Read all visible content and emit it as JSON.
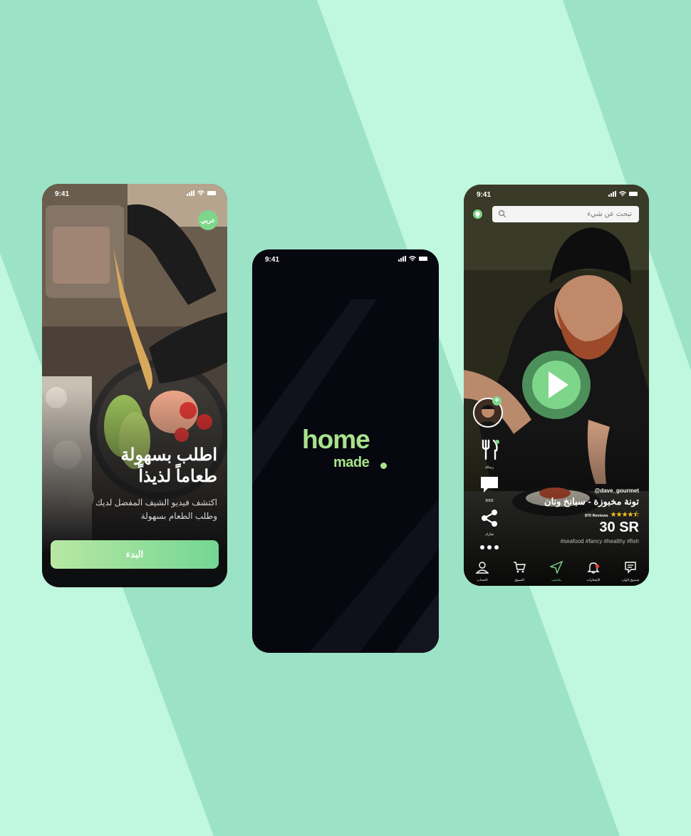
{
  "colors": {
    "background_light": "#bff7df",
    "background_stripe": "#9ce2c6",
    "accent_green": "#7ed68a",
    "logo_green": "#a8e38b",
    "dark": "#07070f"
  },
  "status_bar": {
    "time": "9:41"
  },
  "onboarding": {
    "lang_badge": "عربي",
    "headline_line1": "اطلب بسهولة",
    "headline_line2": "طعاماً لذيذاً",
    "subtitle_line1": "اكتشف فيديو الشيف المفضل لديك",
    "subtitle_line2": "وطلب الطعام بسهولة",
    "start_button": "البدء"
  },
  "splash": {
    "logo_line1": "home",
    "logo_line2": "made"
  },
  "feed": {
    "search_placeholder": "تبحث عن شيء",
    "side_actions": [
      {
        "icon": "fork-knife-icon",
        "label": "رسالة"
      },
      {
        "icon": "comment-icon",
        "label": "5003"
      },
      {
        "icon": "share-icon",
        "label": "شارك"
      },
      {
        "icon": "more-icon",
        "label": ""
      }
    ],
    "handle": "@dave_gourmet",
    "dish_title": "تونة مخبوزة - سبانخ ونان",
    "rating": 4.5,
    "reviews": "870 Reviews",
    "price": "30 SR",
    "tags": "#seafood #fancy #healthy #fish",
    "nav": [
      {
        "icon": "inbox-icon",
        "label": "صندوق الوارد"
      },
      {
        "icon": "bell-icon",
        "label": "الإشعارات"
      },
      {
        "icon": "send-icon",
        "label": "يكتشف"
      },
      {
        "icon": "cart-icon",
        "label": "التسوق"
      },
      {
        "icon": "user-icon",
        "label": "الحساب"
      }
    ]
  }
}
